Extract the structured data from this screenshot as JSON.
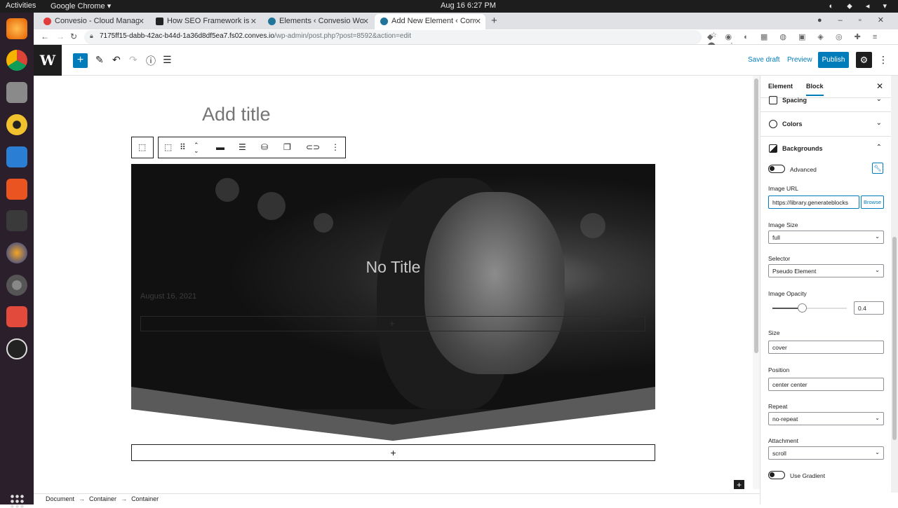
{
  "os": {
    "activities": "Activities",
    "app_name": "Google Chrome ▾",
    "clock": "Aug 16  6:27 PM"
  },
  "browser": {
    "tabs": [
      {
        "title": "Convesio - Cloud Manager",
        "favicon_color": "#e23b3b",
        "active": false
      },
      {
        "title": "How SEO Framework is b",
        "favicon_color": "#222222",
        "active": false
      },
      {
        "title": "Elements ‹ Convesio Word",
        "favicon_color": "#21759b",
        "active": false
      },
      {
        "title": "Add New Element ‹ Conve",
        "favicon_color": "#21759b",
        "active": true
      }
    ],
    "url_host": "7175ff15-dabb-42ac-b44d-1a36d8df5ea7.fs02.conves.io",
    "url_path": "/wp-admin/post.php?post=8592&action=edit"
  },
  "toolbar": {
    "wp_logo": "W",
    "add_label": "+",
    "save_draft": "Save draft",
    "preview": "Preview",
    "publish": "Publish"
  },
  "editor": {
    "title_placeholder": "Add title",
    "hero_title": "No Title",
    "hero_date": "August 16, 2021",
    "append_plus": "+"
  },
  "breadcrumb": [
    "Document",
    "Container",
    "Container"
  ],
  "sidebar": {
    "tab_element": "Element",
    "tab_block": "Block",
    "panels": {
      "spacing": "Spacing",
      "colors": "Colors",
      "backgrounds": "Backgrounds"
    },
    "advanced_label": "Advanced",
    "image_url_label": "Image URL",
    "image_url_value": "https://library.generateblocks",
    "browse": "Browse",
    "image_size_label": "Image Size",
    "image_size_value": "full",
    "selector_label": "Selector",
    "selector_value": "Pseudo Element",
    "image_opacity_label": "Image Opacity",
    "image_opacity_value": "0.4",
    "image_opacity": 0.4,
    "size_label": "Size",
    "size_value": "cover",
    "position_label": "Position",
    "position_value": "center center",
    "repeat_label": "Repeat",
    "repeat_value": "no-repeat",
    "attachment_label": "Attachment",
    "attachment_value": "scroll",
    "use_gradient_label": "Use Gradient"
  }
}
